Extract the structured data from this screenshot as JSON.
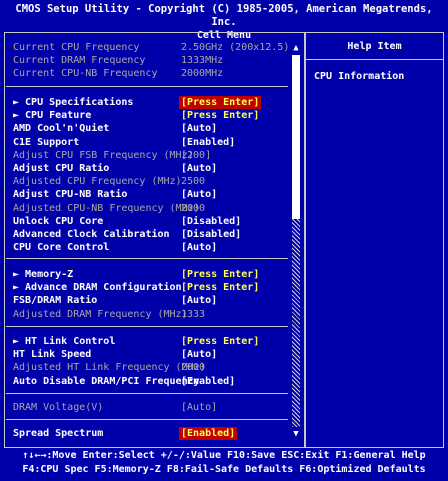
{
  "header": {
    "title": "CMOS Setup Utility - Copyright (C) 1985-2005, American Megatrends, Inc.",
    "subtitle": "Cell Menu"
  },
  "info": [
    {
      "label": "Current CPU Frequency",
      "value": "2.50GHz (200x12.5)"
    },
    {
      "label": "Current DRAM Frequency",
      "value": "1333MHz"
    },
    {
      "label": "Current CPU-NB Frequency",
      "value": "2000MHz"
    }
  ],
  "group1": [
    {
      "label": "► CPU Specifications",
      "value": "[Press Enter]",
      "style": "sel"
    },
    {
      "label": "► CPU Feature",
      "value": "[Press Enter]",
      "style": "yellow"
    },
    {
      "label": "AMD Cool'n'Quiet",
      "value": "[Auto]",
      "style": "white"
    },
    {
      "label": "C1E Support",
      "value": "[Enabled]",
      "style": "white"
    },
    {
      "label": "Adjust CPU FSB Frequency (MHz)",
      "value": "[200]",
      "style": "dim"
    },
    {
      "label": "Adjust CPU Ratio",
      "value": "[Auto]",
      "style": "white"
    },
    {
      "label": "Adjusted CPU Frequency (MHz)",
      "value": "2500",
      "style": "dim"
    },
    {
      "label": "Adjust CPU-NB Ratio",
      "value": "[Auto]",
      "style": "white"
    },
    {
      "label": "Adjusted CPU-NB Frequency (MHz)",
      "value": "2000",
      "style": "dim"
    },
    {
      "label": "Unlock CPU Core",
      "value": "[Disabled]",
      "style": "white"
    },
    {
      "label": "Advanced Clock Calibration",
      "value": "[Disabled]",
      "style": "white"
    },
    {
      "label": "CPU Core Control",
      "value": "[Auto]",
      "style": "white"
    }
  ],
  "group2": [
    {
      "label": "► Memory-Z",
      "value": "[Press Enter]",
      "style": "yellow"
    },
    {
      "label": "► Advance DRAM Configuration",
      "value": "[Press Enter]",
      "style": "yellow"
    },
    {
      "label": "FSB/DRAM Ratio",
      "value": "[Auto]",
      "style": "white"
    },
    {
      "label": "Adjusted DRAM Frequency (MHz)",
      "value": "1333",
      "style": "dim"
    }
  ],
  "group3": [
    {
      "label": "► HT Link Control",
      "value": "[Press Enter]",
      "style": "yellow"
    },
    {
      "label": "HT Link Speed",
      "value": "[Auto]",
      "style": "white"
    },
    {
      "label": "Adjusted HT Link Frequency (MHz)",
      "value": "2000",
      "style": "dim"
    },
    {
      "label": "Auto Disable DRAM/PCI Frequency",
      "value": "[Enabled]",
      "style": "white"
    }
  ],
  "group4": [
    {
      "label": "DRAM Voltage(V)",
      "value": "[Auto]",
      "style": "dim"
    }
  ],
  "group5": [
    {
      "label": "Spread Spectrum",
      "value": "[Enabled]",
      "style": "sel"
    }
  ],
  "help": {
    "title": "Help Item",
    "text": "CPU Information"
  },
  "footer": {
    "line1": "↑↓←→:Move  Enter:Select  +/-/:Value  F10:Save  ESC:Exit  F1:General Help",
    "line2": "F4:CPU Spec  F5:Memory-Z  F8:Fail-Safe Defaults    F6:Optimized Defaults"
  },
  "scrollbar": {
    "position_fraction": 0.0,
    "visible_fraction": 0.44
  },
  "colors": {
    "background": "#0000aa",
    "highlight_bg": "#c00000",
    "highlight_fg": "#ffff55",
    "dim": "#a8a8a8",
    "frame": "#c8c8c8"
  },
  "icons": {
    "up": "triangle-up-icon",
    "down": "triangle-down-icon"
  }
}
